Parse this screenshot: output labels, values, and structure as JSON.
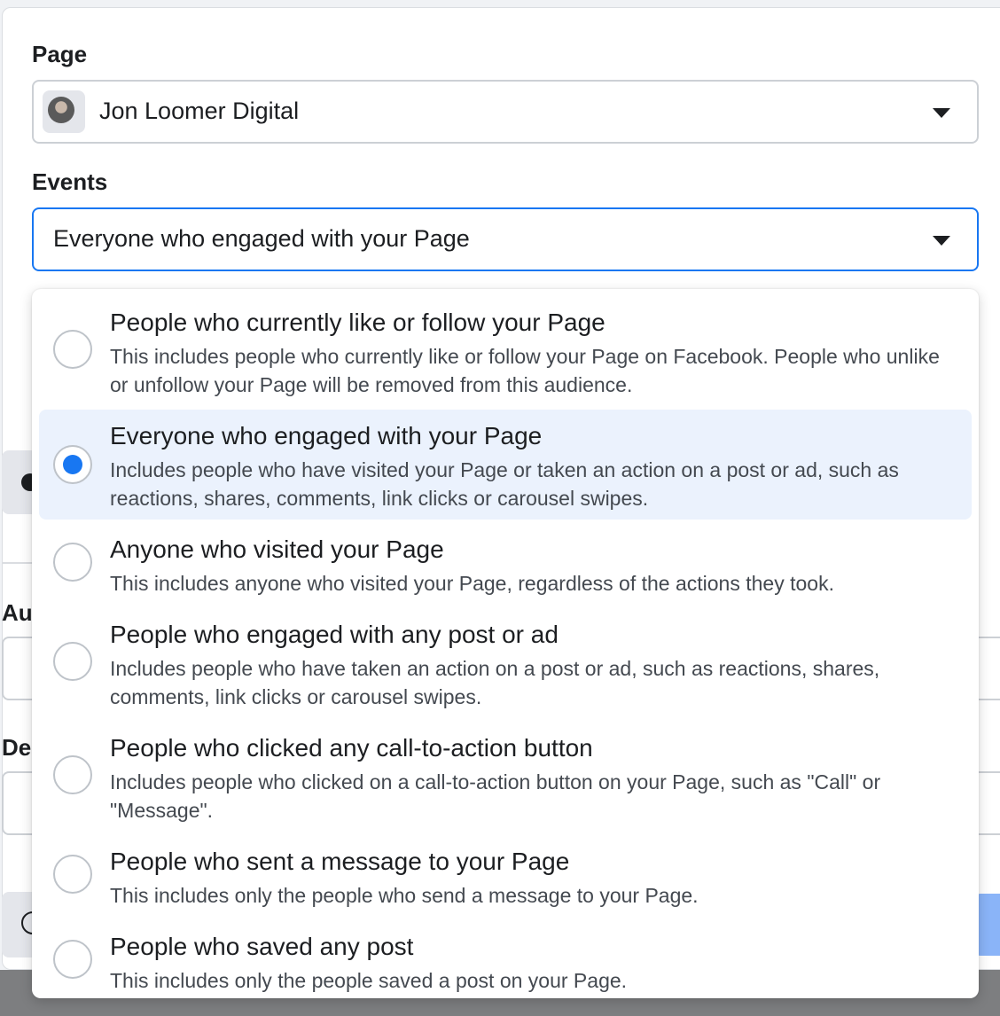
{
  "page_field": {
    "label": "Page",
    "selected_value": "Jon Loomer Digital",
    "avatar_icon": "profile-photo"
  },
  "events_field": {
    "label": "Events",
    "selected_value": "Everyone who engaged with your Page"
  },
  "background": {
    "label_au": "Au",
    "label_de": "De"
  },
  "event_options": [
    {
      "title": "People who currently like or follow your Page",
      "description": "This includes people who currently like or follow your Page on Facebook. People who unlike or unfollow your Page will be removed from this audience.",
      "selected": false
    },
    {
      "title": "Everyone who engaged with your Page",
      "description": "Includes people who have visited your Page or taken an action on a post or ad, such as reactions, shares, comments, link clicks or carousel swipes.",
      "selected": true
    },
    {
      "title": "Anyone who visited your Page",
      "description": "This includes anyone who visited your Page, regardless of the actions they took.",
      "selected": false
    },
    {
      "title": "People who engaged with any post or ad",
      "description": "Includes people who have taken an action on a post or ad, such as reactions, shares, comments, link clicks or carousel swipes.",
      "selected": false
    },
    {
      "title": "People who clicked any call-to-action button",
      "description": "Includes people who clicked on a call-to-action button on your Page, such as \"Call\" or \"Message\".",
      "selected": false
    },
    {
      "title": "People who sent a message to your Page",
      "description": "This includes only the people who send a message to your Page.",
      "selected": false
    },
    {
      "title": "People who saved any post",
      "description": "This includes only the people saved a post on your Page.",
      "selected": false
    }
  ],
  "colors": {
    "accent": "#1877f2",
    "selected_row": "#ebf2fd"
  }
}
